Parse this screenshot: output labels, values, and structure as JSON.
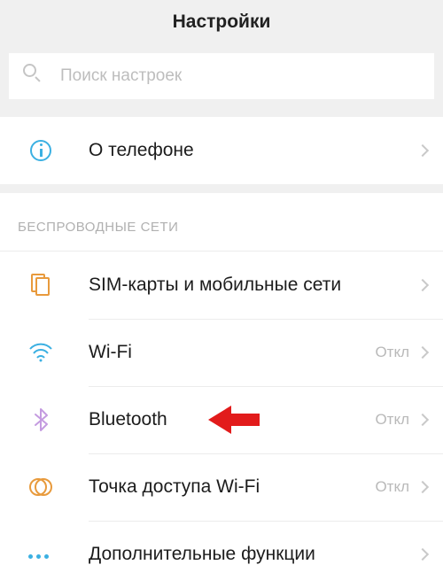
{
  "header": {
    "title": "Настройки"
  },
  "search": {
    "placeholder": "Поиск настроек"
  },
  "about": {
    "label": "О телефоне"
  },
  "wireless_section": {
    "title": "БЕСПРОВОДНЫЕ СЕТИ"
  },
  "rows": {
    "sim": {
      "label": "SIM-карты и мобильные сети",
      "status": ""
    },
    "wifi": {
      "label": "Wi-Fi",
      "status": "Откл"
    },
    "bt": {
      "label": "Bluetooth",
      "status": "Откл"
    },
    "hotspot": {
      "label": "Точка доступа Wi-Fi",
      "status": "Откл"
    },
    "more": {
      "label": "Дополнительные функции",
      "status": ""
    }
  }
}
